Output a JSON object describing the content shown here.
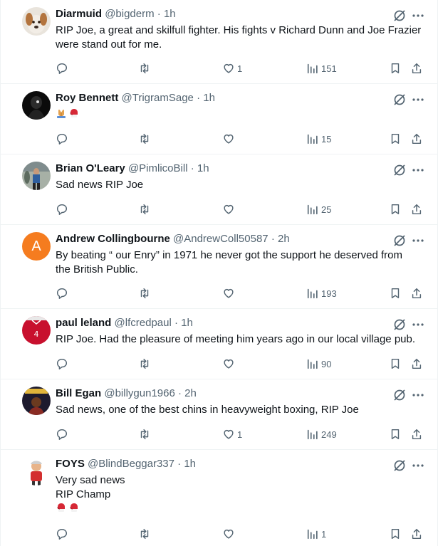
{
  "colors": {
    "text": "#0f1419",
    "secondary": "#536471",
    "divider": "#eff3f4"
  },
  "tweets": [
    {
      "avatar": "dog-photo-avatar",
      "name": "Diarmuid",
      "handle": "@bigderm",
      "sep": "·",
      "time": "1h",
      "lines": [
        "RIP Joe, a great and skilfull fighter. His fights v Richard Dunn and Joe Frazier",
        "were stand out for me."
      ],
      "replies": "",
      "retweets": "",
      "likes": "1",
      "views": "151"
    },
    {
      "avatar": "dark-figure-avatar",
      "name": "Roy Bennett",
      "handle": "@TrigramSage",
      "sep": "·",
      "time": "1h",
      "lines": [
        ""
      ],
      "emojis": [
        "folded-hands-emoji",
        "boxing-glove-emoji"
      ],
      "replies": "",
      "retweets": "",
      "likes": "",
      "views": "15"
    },
    {
      "avatar": "runner-photo-avatar",
      "name": "Brian O'Leary",
      "handle": "@PimlicoBill",
      "sep": "·",
      "time": "1h",
      "lines": [
        "Sad news RIP Joe"
      ],
      "replies": "",
      "retweets": "",
      "likes": "",
      "views": "25"
    },
    {
      "avatar": "letter-a-avatar",
      "avatar_letter": "A",
      "avatar_color": "#f57c1f",
      "name": "Andrew Collingbourne",
      "handle": "@AndrewColl50587",
      "sep": "·",
      "time": "2h",
      "lines": [
        "By beating “ our Enry” in 1971 he never got the support he deserved from",
        "the British Public."
      ],
      "replies": "",
      "retweets": "",
      "likes": "",
      "views": "193"
    },
    {
      "avatar": "red-shirt-avatar",
      "name": "paul leland",
      "handle": "@lfcredpaul",
      "sep": "·",
      "time": "1h",
      "lines": [
        "RIP Joe. Had the pleasure of meeting him years ago in our local village pub."
      ],
      "replies": "",
      "retweets": "",
      "likes": "",
      "views": "90"
    },
    {
      "avatar": "album-cover-avatar",
      "name": "Bill Egan",
      "handle": "@billygun1966",
      "sep": "·",
      "time": "2h",
      "lines": [
        "Sad news, one of the best chins in heavyweight boxing, RIP Joe"
      ],
      "replies": "",
      "retweets": "",
      "likes": "1",
      "views": "249"
    },
    {
      "avatar": "cartoon-figure-avatar",
      "name": "FOYS",
      "handle": "@BlindBeggar337",
      "sep": "·",
      "time": "1h",
      "lines": [
        "Very sad news",
        "RIP Champ",
        ""
      ],
      "emojis_line3": [
        "boxing-glove-emoji",
        "boxing-glove-emoji"
      ],
      "replies": "",
      "retweets": "",
      "likes": "",
      "views": "1"
    }
  ]
}
